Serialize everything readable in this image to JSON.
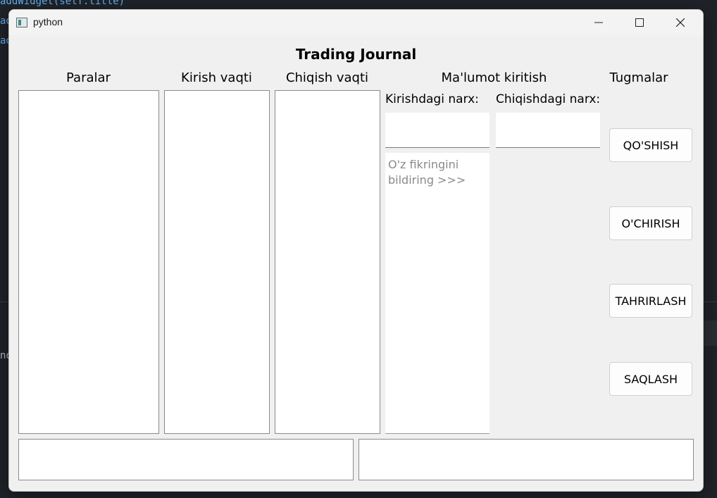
{
  "background_code": {
    "line1": "addWidget(self.title)",
    "line2": "ad",
    "line3": "ad",
    "line4": "no"
  },
  "window": {
    "title": "python",
    "icon": "app-window-icon"
  },
  "app": {
    "heading": "Trading Journal",
    "columns": {
      "pairs": "Paralar",
      "entry_time": "Kirish vaqti",
      "exit_time": "Chiqish vaqti",
      "data_entry": "Ma'lumot kiritish",
      "buttons": "Tugmalar"
    },
    "inputs": {
      "entry_price_label": "Kirishdagi narx:",
      "exit_price_label": "Chiqishdagi narx:",
      "entry_price_value": "",
      "exit_price_value": "",
      "comment_placeholder": "O'z fikringini bildiring >>>"
    },
    "actions": {
      "add": "QO'SHISH",
      "delete": "O'CHIRISH",
      "edit": "TAHRIRLASH",
      "save": "SAQLASH"
    }
  }
}
